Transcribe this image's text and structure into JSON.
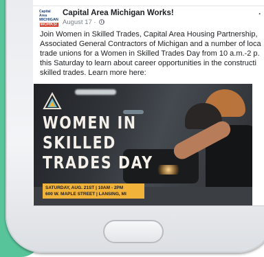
{
  "colors": {
    "teal_background": "#58c49a",
    "logo_red": "#d23a2a",
    "logo_blue": "#1d3f7a",
    "banner_yellow": "#f2b33a"
  },
  "post": {
    "org_logo": {
      "line1": "Capital Area",
      "line2": "MICHIGAN",
      "line3": "WORKS!"
    },
    "author": "Capital Area Michigan Works!",
    "date": "August 17 ·",
    "privacy_icon": "globe-icon",
    "more_icon": "more-options-icon",
    "more_symbol": "·",
    "text_lines": [
      "Join Women in Skilled Trades, Capital Area Housing Partnership,",
      "Associated General Contractors of Michigan and a number of loca",
      "trade unions for a Women in Skilled Trades Day from 10 a.m.-2 p.",
      "this Saturday to learn about career opportunities in the constructi",
      "skilled trades. Learn more here:"
    ],
    "image": {
      "title_lines": [
        "WOMEN IN",
        "SKILLED",
        "TRADES DAY"
      ],
      "banner_lines": [
        "SATURDAY, AUG. 21ST | 10AM - 2PM",
        "600 W. MAPLE STREET | LANSING, MI"
      ]
    }
  },
  "device": {
    "home_button_icon": "home-button"
  }
}
